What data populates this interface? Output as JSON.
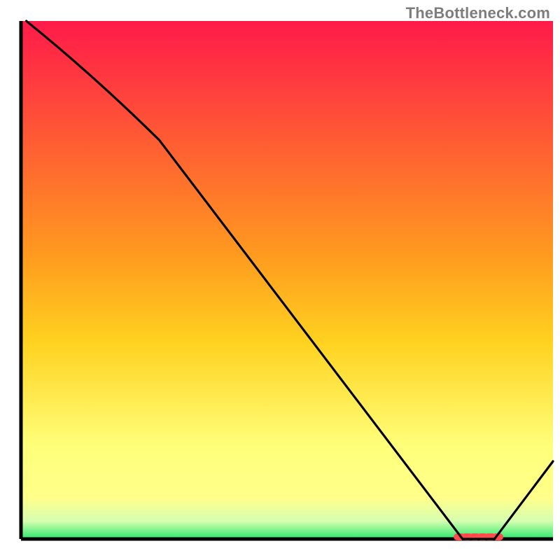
{
  "watermark": "TheBottleneck.com",
  "colors": {
    "gradient_top": "#ff1a4a",
    "gradient_mid": "#ffd21f",
    "gradient_yellow_light": "#ffff8a",
    "gradient_green": "#2be86d",
    "axis": "#000000",
    "line": "#000000",
    "marker_fill": "#ff4a4a",
    "marker_stroke": "#b03030"
  },
  "chart_data": {
    "type": "line",
    "title": "",
    "xlabel": "",
    "ylabel": "",
    "xlim": [
      0,
      100
    ],
    "ylim": [
      0,
      100
    ],
    "x": [
      1,
      26,
      83,
      89,
      100
    ],
    "values": [
      100,
      77,
      0,
      0,
      15
    ],
    "marker_segment": {
      "x_start": 82,
      "x_end": 90,
      "y": 0
    },
    "notes": "Heat-gradient background from red (top) through orange/yellow to green (bottom). Single black curve descends from top-left, has a slight knee around x≈26, reaches zero around x≈83–89 where a short red dashed segment sits on the baseline, then rises toward x=100."
  }
}
